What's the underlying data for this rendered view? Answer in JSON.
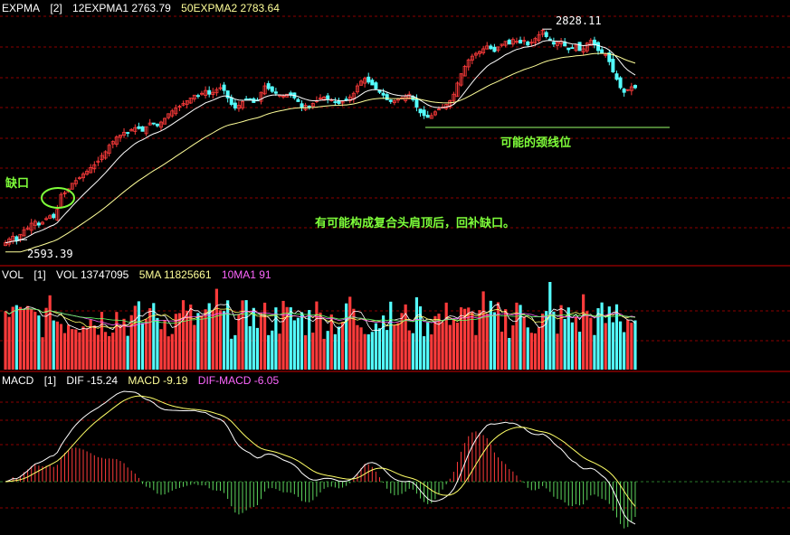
{
  "price_panel": {
    "indicator": "EXPMA",
    "param": "[2]",
    "ema12_label": "12EXPMA1 2763.79",
    "ema50_label": "50EXPMA2 2783.64",
    "high_label": "2828.11",
    "low_label": "2593.39",
    "annotation_gap": "缺口",
    "annotation_neckline": "可能的颈线位",
    "annotation_main": "有可能构成复合头肩顶后，回补缺口。"
  },
  "vol_panel": {
    "indicator": "VOL",
    "param": "[1]",
    "vol_label": "VOL 13747095",
    "ma5_label": "5MA 11825661",
    "ma10_label": "10MA1 91"
  },
  "macd_panel": {
    "indicator": "MACD",
    "param": "[1]",
    "dif_label": "DIF -15.24",
    "macd_label": "MACD -9.19",
    "difmacd_label": "DIF-MACD -6.05"
  },
  "colors": {
    "up": "#ff3b3b",
    "down": "#54ffff",
    "ema_short": "#ffffff",
    "ema_long": "#ffff99",
    "grid": "#8b0000",
    "annotation": "#7fff3a",
    "header_text": "#ffffff",
    "difmacd_text": "#ff66ff"
  },
  "chart_data": [
    {
      "type": "candlestick",
      "ylim": [
        2580,
        2840
      ],
      "annotated_high": 2828.11,
      "annotated_low": 2593.39,
      "ema12_last": 2763.79,
      "ema50_last": 2783.64,
      "close": [
        2596,
        2600,
        2603,
        2598,
        2605,
        2610,
        2612,
        2617,
        2619,
        2615,
        2618,
        2622,
        2625,
        2623,
        2632,
        2648,
        2650,
        2654,
        2660,
        2663,
        2666,
        2670,
        2673,
        2677,
        2680,
        2684,
        2690,
        2694,
        2701,
        2705,
        2710,
        2712,
        2715,
        2714,
        2718,
        2720,
        2719,
        2716,
        2721,
        2725,
        2724,
        2722,
        2726,
        2730,
        2735,
        2738,
        2741,
        2743,
        2746,
        2749,
        2752,
        2755,
        2754,
        2757,
        2760,
        2756,
        2758,
        2761,
        2763,
        2760,
        2752,
        2745,
        2741,
        2744,
        2748,
        2750,
        2751,
        2747,
        2749,
        2758,
        2765,
        2762,
        2759,
        2757,
        2755,
        2754,
        2756,
        2755,
        2752,
        2748,
        2742,
        2744,
        2743,
        2746,
        2749,
        2752,
        2753,
        2751,
        2750,
        2747,
        2746,
        2748,
        2750,
        2753,
        2757,
        2765,
        2770,
        2773,
        2769,
        2766,
        2762,
        2758,
        2755,
        2750,
        2748,
        2749,
        2751,
        2752,
        2754,
        2756,
        2750,
        2742,
        2736,
        2733,
        2731,
        2733,
        2737,
        2740,
        2742,
        2745,
        2749,
        2756,
        2768,
        2778,
        2786,
        2793,
        2797,
        2800,
        2802,
        2805,
        2808,
        2805,
        2802,
        2807,
        2810,
        2813,
        2810,
        2815,
        2813,
        2811,
        2814,
        2809,
        2812,
        2816,
        2820,
        2825,
        2818,
        2815,
        2810,
        2812,
        2813,
        2808,
        2804,
        2806,
        2809,
        2803,
        2805,
        2811,
        2814,
        2809,
        2803,
        2800,
        2799,
        2791,
        2780,
        2772,
        2763,
        2758,
        2761,
        2764,
        2763
      ],
      "volume_shape": "variable, peak near start and middle",
      "macd_dif_last": -15.24,
      "macd_dea_last": -9.19,
      "macd_hist_last": -6.05
    }
  ]
}
